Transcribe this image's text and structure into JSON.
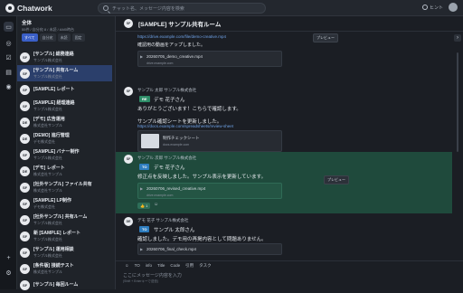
{
  "app": {
    "name": "Chatwork"
  },
  "search": {
    "placeholder": "チャット名、メッセージ内容を検索"
  },
  "topbar": {
    "hint_label": "ヒント"
  },
  "sidebar": {
    "group_title": "全体",
    "group_sub": "55件 / 自分宛 8 / 未読 / AM0時台",
    "filters": [
      "すべて",
      "自分宛",
      "未読",
      "固定"
    ],
    "rooms": [
      {
        "icon": "SF",
        "name": "[サンプル] 総務連絡",
        "sub": "サンプル株式会社"
      },
      {
        "icon": "SF",
        "name": "[サンプル] 共有ルーム",
        "sub": "サンプル株式会社",
        "active": true
      },
      {
        "icon": "SF",
        "name": "[SAMPLE] レポート",
        "sub": ""
      },
      {
        "icon": "SF",
        "name": "[SAMPLE] 経理連絡",
        "sub": "サンプル株式会社"
      },
      {
        "icon": "DE",
        "name": "[デモ] 広告運用",
        "sub": "株式会社サンプル"
      },
      {
        "icon": "DE",
        "name": "[DEMO] 進行管理",
        "sub": "デモ株式会社"
      },
      {
        "icon": "SF",
        "name": "[SAMPLE] バナー制作",
        "sub": "サンプル株式会社"
      },
      {
        "icon": "DE",
        "name": "[デモ] レポート",
        "sub": "株式会社サンプル"
      },
      {
        "icon": "SF",
        "name": "[社外サンプル] ファイル共有",
        "sub": "株式会社サンプル"
      },
      {
        "icon": "SF",
        "name": "[SAMPLE] LP制作",
        "sub": "デモ株式会社"
      },
      {
        "icon": "SF",
        "name": "[社外サンプル] 共有ルーム",
        "sub": "サンプル株式会社"
      },
      {
        "icon": "SF",
        "name": "新 [SAMPLE] レポート",
        "sub": "サンプル株式会社"
      },
      {
        "icon": "SF",
        "name": "[サンプル] 運用相談",
        "sub": "サンプル株式会社"
      },
      {
        "icon": "SF",
        "name": "[条件版] 接続テスト",
        "sub": "株式会社サンプル"
      },
      {
        "icon": "SF",
        "name": "[サンプル] 毎回ルーム",
        "sub": ""
      }
    ]
  },
  "room": {
    "icon": "SF",
    "title": "[SAMPLE] サンプル共有ルーム"
  },
  "messages": {
    "m0": {
      "link": "https://drive.example.com/file/demo-creative.mp4",
      "preview": "プレビュー",
      "text": "確認用の動画をアップしました。",
      "file_name": "20260705_demo_creative.mp4",
      "file_domain": "drive.example.com"
    },
    "m1": {
      "avatar": "SF",
      "sender": "サンプル 太郎 サンプル株式会社",
      "tag": "RE",
      "tag_name": "デモ 花子さん",
      "line1": "ありがとうございます！こちらで確認します。",
      "line2": "サンプル確認シートを更新しました。",
      "link": "https://docs.example.com/spreadsheets/review-sheet",
      "card_title": "制作チェックシート",
      "card_domain": "docs.example.com"
    },
    "m2": {
      "avatar": "SF",
      "sender": "サンプル 次郎 サンプル株式会社",
      "tag": "TO",
      "tag_name": "デモ 花子さん",
      "line1": "修正点を反映しました。サンプル表示を更新しています。",
      "preview": "プレビュー",
      "file_name": "20260706_revised_creative.mp4",
      "file_domain": "drive.example.com",
      "reaction": "1"
    },
    "m3": {
      "avatar": "DE",
      "sender": "デモ 花子 サンプル株式会社",
      "tag": "TO",
      "tag_name": "サンプル 太郎さん",
      "line1": "確認しました。デモ用の再掲内容として問題ありません。",
      "file_name": "20260706_final_check.mp4"
    }
  },
  "composer": {
    "toolbar": [
      "TO",
      "info",
      "Title",
      "Code",
      "引用",
      "タスク"
    ],
    "placeholder": "ここにメッセージ内容を入力",
    "sub": "(Shift + Enterキーで送信)"
  }
}
